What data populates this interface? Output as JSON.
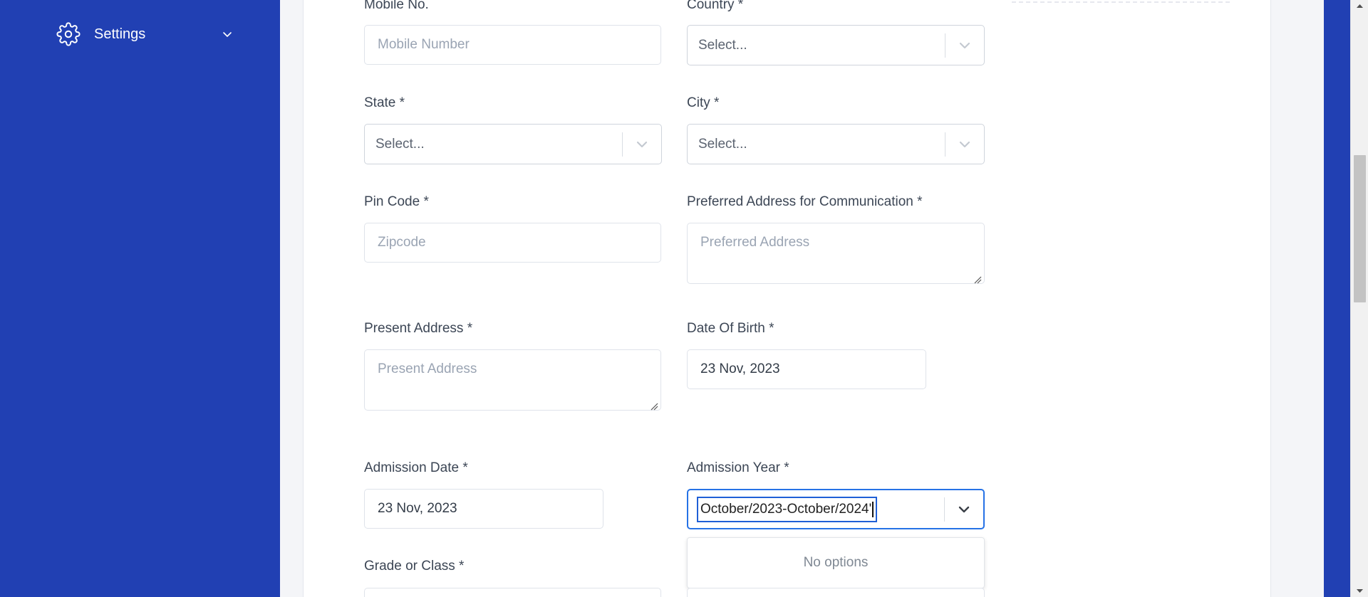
{
  "sidebar": {
    "settings_label": "Settings",
    "settings_icon": "gear-icon",
    "chevron_icon": "chevron-down-icon"
  },
  "form": {
    "mobile": {
      "label": "Mobile No.",
      "placeholder": "Mobile Number"
    },
    "country": {
      "label": "Country *",
      "value": "Select..."
    },
    "state": {
      "label": "State *",
      "value": "Select..."
    },
    "city": {
      "label": "City *",
      "value": "Select..."
    },
    "pincode": {
      "label": "Pin Code *",
      "placeholder": "Zipcode"
    },
    "preferred_address": {
      "label": "Preferred Address for Communication *",
      "placeholder": "Preferred Address"
    },
    "present_address": {
      "label": "Present Address *",
      "placeholder": "Present Address"
    },
    "dob": {
      "label": "Date Of Birth *",
      "value": "23 Nov, 2023"
    },
    "admission_date": {
      "label": "Admission Date *",
      "value": "23 Nov, 2023"
    },
    "admission_year": {
      "label": "Admission Year *",
      "typed_value": "October/2023-October/2024'",
      "menu_text": "No options"
    },
    "grade": {
      "label": "Grade or Class *"
    }
  },
  "colors": {
    "sidebar_bg": "#2140b3",
    "focus_border": "#2672e6"
  }
}
